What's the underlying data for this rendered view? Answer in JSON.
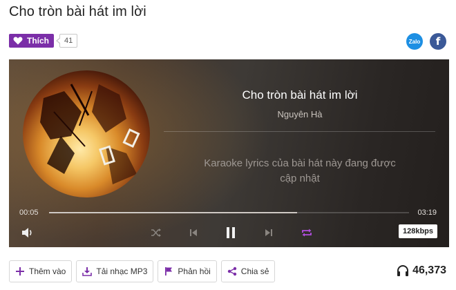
{
  "song": {
    "title": "Cho tròn bài hát im lời",
    "artist": "Nguyên Hà"
  },
  "social": {
    "like_label": "Thích",
    "like_count": "41",
    "share_icons": [
      "zalo-icon",
      "facebook-icon"
    ],
    "zalo_label": "Zalo",
    "facebook_label": "f"
  },
  "player": {
    "lyrics_note": "Karaoke lyrics của bài hát này đang được cập nhật",
    "current_time": "00:05",
    "total_time": "03:19",
    "progress_fraction": 0.69,
    "bitrate": "128kbps",
    "controls": [
      "volume-icon",
      "shuffle-icon",
      "previous-icon",
      "pause-icon",
      "next-icon",
      "repeat-icon"
    ],
    "repeat_active": true
  },
  "actions": [
    {
      "label": "Thêm vào",
      "icon": "plus-icon"
    },
    {
      "label": "Tải nhạc MP3",
      "icon": "download-icon"
    },
    {
      "label": "Phản hồi",
      "icon": "flag-icon"
    },
    {
      "label": "Chia sẻ",
      "icon": "share-icon"
    }
  ],
  "listen_count": "46,373",
  "colors": {
    "accent": "#7b2ea8",
    "zalo": "#1d8fe3",
    "facebook": "#3b5998"
  }
}
